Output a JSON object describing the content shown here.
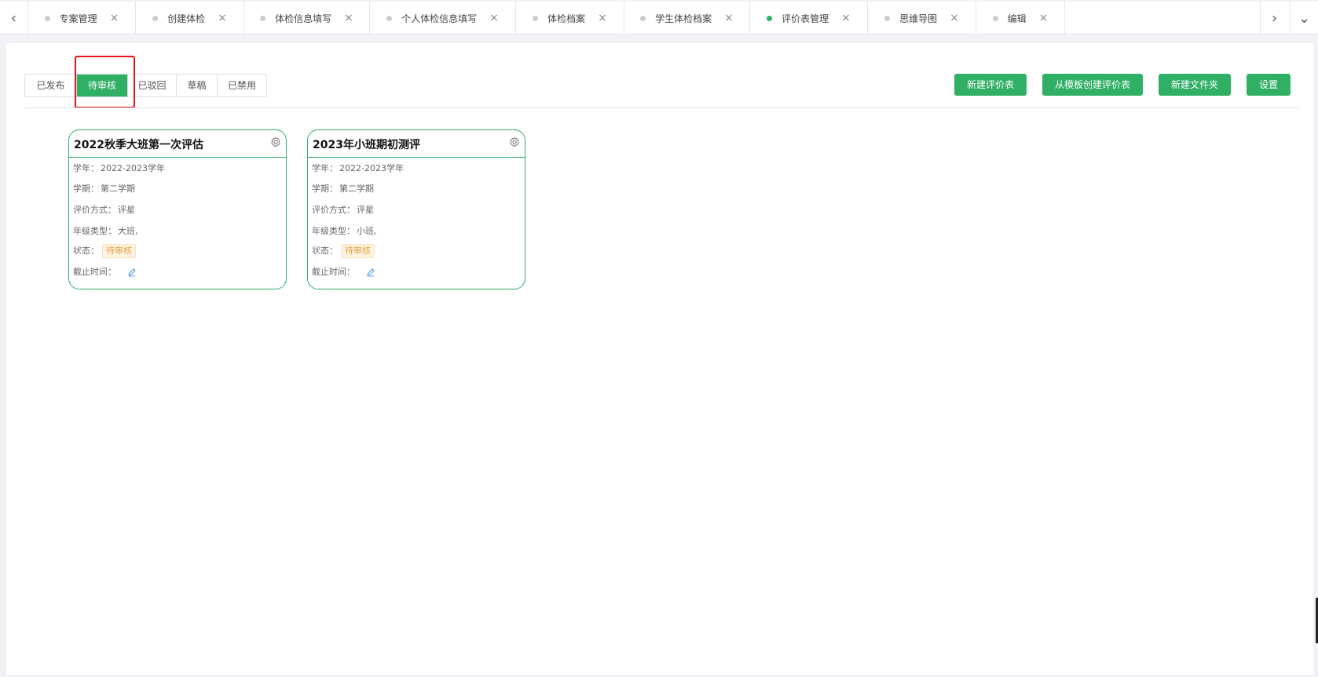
{
  "tabs": [
    {
      "label": "专案管理",
      "active": false
    },
    {
      "label": "创建体检",
      "active": false
    },
    {
      "label": "体检信息填写",
      "active": false
    },
    {
      "label": "个人体检信息填写",
      "active": false
    },
    {
      "label": "体检档案",
      "active": false
    },
    {
      "label": "学生体检档案",
      "active": false
    },
    {
      "label": "评价表管理",
      "active": true
    },
    {
      "label": "思维导图",
      "active": false
    },
    {
      "label": "编辑",
      "active": false
    }
  ],
  "icons": {
    "tab_close": "×",
    "nav_left": "‹",
    "nav_right": "›",
    "nav_menu": "⌄"
  },
  "filters": [
    {
      "label": "已发布",
      "active": false
    },
    {
      "label": "待审核",
      "active": true
    },
    {
      "label": "已驳回",
      "active": false
    },
    {
      "label": "草稿",
      "active": false
    },
    {
      "label": "已禁用",
      "active": false
    }
  ],
  "actions": {
    "new_form": "新建评价表",
    "from_template": "从模板创建评价表",
    "new_folder": "新建文件夹",
    "settings": "设置"
  },
  "cards": [
    {
      "title": "2022秋季大班第一次评估",
      "year_label": "学年：",
      "year": "2022-2023学年",
      "term_label": "学期：",
      "term": "第二学期",
      "method_label": "评价方式：",
      "method": "评星",
      "grade_label": "年级类型：",
      "grade": "大班,",
      "status_label": "状态：",
      "status": "待审核",
      "deadline_label": "截止时间："
    },
    {
      "title": "2023年小班期初测评",
      "year_label": "学年：",
      "year": "2022-2023学年",
      "term_label": "学期：",
      "term": "第二学期",
      "method_label": "评价方式：",
      "method": "评星",
      "grade_label": "年级类型：",
      "grade": "小班,",
      "status_label": "状态：",
      "status": "待审核",
      "deadline_label": "截止时间："
    }
  ],
  "colors": {
    "accent": "#2fb065",
    "highlight": "#e8131a",
    "status_text": "#e6a23c"
  }
}
